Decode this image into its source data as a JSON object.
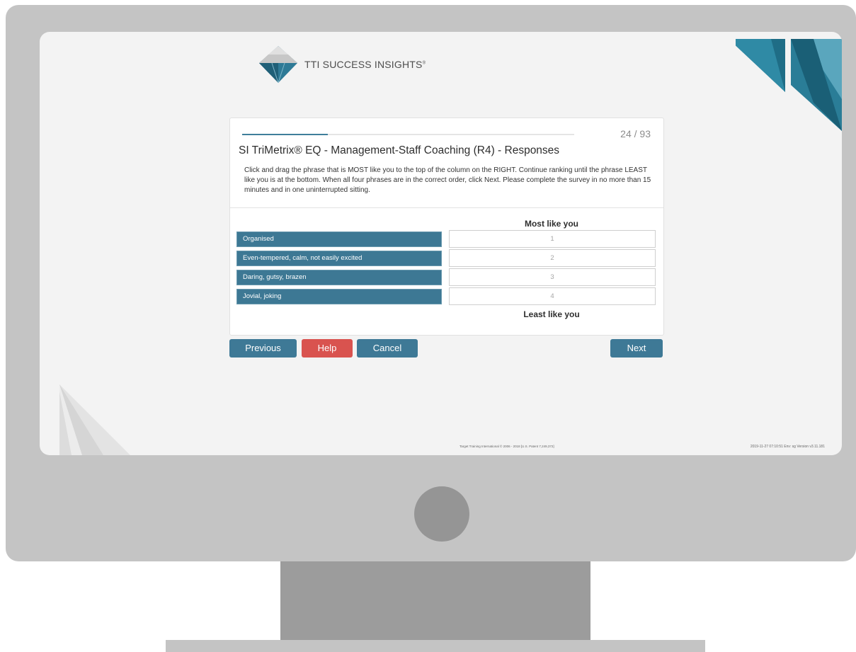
{
  "brand": {
    "name": "TTI SUCCESS INSIGHTS",
    "reg_mark": "®"
  },
  "progress": {
    "current": 24,
    "total": 93,
    "label": "24 / 93"
  },
  "survey": {
    "title": "SI TriMetrix® EQ - Management-Staff Coaching (R4) - Responses",
    "instructions": "Click and drag the phrase that is MOST like you to the top of the column on the RIGHT. Continue ranking until the phrase LEAST like you is at the bottom. When all four phrases are in the correct order, click Next. Please complete the survey in no more than 15 minutes and in one uninterrupted sitting.",
    "most_label": "Most like you",
    "least_label": "Least like you",
    "phrases": [
      "Organised",
      "Even-tempered, calm, not easily excited",
      "Daring, gutsy, brazen",
      "Jovial, joking"
    ],
    "slots": [
      "1",
      "2",
      "3",
      "4"
    ]
  },
  "buttons": {
    "previous": "Previous",
    "help": "Help",
    "cancel": "Cancel",
    "next": "Next"
  },
  "footer": {
    "copyright": "Target Training International © 2006 - 2018  [U.S. Patent 7,249,372]",
    "meta": "2019-11-27 07:10:51   Env: sg   Version v3.11.181"
  },
  "colors": {
    "accent": "#3e7996",
    "danger": "#d9534f",
    "bezel": "#c4c4c4",
    "screen": "#f3f3f3"
  }
}
